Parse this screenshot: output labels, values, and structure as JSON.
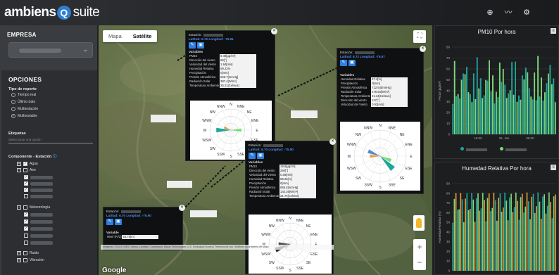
{
  "app": {
    "logo_part1": "ambiens",
    "logo_q": "Q",
    "logo_part2": "suite"
  },
  "topbar": {
    "icons": [
      "plus-circle-icon",
      "chart-line-icon",
      "settings-icon"
    ]
  },
  "sidebar": {
    "empresa_label": "EMPRESA",
    "opciones_label": "OPCIONES",
    "tipo_reporte_label": "Tipo de reporte",
    "report_types": [
      {
        "label": "Tiempo real",
        "checked": false
      },
      {
        "label": "Último dato",
        "checked": false
      },
      {
        "label": "Multiestación",
        "checked": false
      },
      {
        "label": "Multivariable",
        "checked": true
      }
    ],
    "etiquetas_label": "Etiquetas",
    "etiquetas_placeholder": "Seleccionar una opción",
    "componente_label": "Componente - Estación",
    "tree": [
      {
        "label": "Agua",
        "level": 0,
        "checked": true
      },
      {
        "label": "Aire",
        "level": 0,
        "checked": false
      },
      {
        "label": "Meteorología",
        "level": 0,
        "checked": false
      },
      {
        "label": "Ruido",
        "level": 0,
        "checked": false
      },
      {
        "label": "Vibración",
        "level": 0,
        "checked": false
      }
    ]
  },
  "map": {
    "tabs": [
      "Mapa",
      "Satélite"
    ],
    "active_tab": "Satélite",
    "google_label": "Google",
    "attribution": "Imágenes ©2023 CNES / Airbus, Landsat / Copernicus, Maxar Technologies, U.S. Geological Survey | Términos de uso | Notificar un problema de Maps",
    "zoom_in": "+",
    "zoom_out": "−"
  },
  "popups": [
    {
      "est": "Estación:",
      "lat": "Latitud: 6.72 Longitud: -75.91",
      "var_label": "Variables",
      "rows": [
        [
          "PM10",
          "6.49[µg/m³]"
        ],
        [
          "Dirección del viento",
          "66[°]"
        ],
        [
          "Velocidad del Viento",
          "1.94[m/s]"
        ],
        [
          "Humedad Relativa",
          "69.22%"
        ],
        [
          "Precipitación",
          "0[mm]"
        ],
        [
          "Presión Atmosférica",
          "629.7[mmHg]"
        ],
        [
          "Radiación Solar",
          "387.4[W/m²]"
        ],
        [
          "Temperatura Ambiente",
          "25.21[Celsius]"
        ]
      ]
    },
    {
      "est": "Estación:",
      "lat": "Latitud: 6.72 Longitud: -75.87",
      "var_label": "Variables",
      "rows": [
        [
          "Humedad Relativa",
          "67.4[%]"
        ],
        [
          "Precipitación",
          "0[mm]"
        ],
        [
          "Presión Atmosférica",
          "712.64[mmHg]"
        ],
        [
          "Radiación Solar",
          "476.55[W/m²]"
        ],
        [
          "Temperatura Ambiente",
          "21.24[Celsius]"
        ],
        [
          "Dirección del viento",
          "117[°]"
        ],
        [
          "Velocidad del Viento",
          "0.92[m/s]"
        ]
      ]
    },
    {
      "est": "Estación:",
      "lat": "Latitud: 6.70 Longitud: -75.90",
      "var_label": "Variables",
      "rows": [
        [
          "PM10",
          "19.8[µg/m³]"
        ],
        [
          "Dirección del viento",
          "260[°]"
        ],
        [
          "Velocidad del Viento",
          "0.08[m/s]"
        ],
        [
          "Humedad Relativa",
          "88.25[%]"
        ],
        [
          "Precipitación",
          "0[mm]"
        ],
        [
          "Presión Atmosférica",
          "665.4[mmHg]"
        ],
        [
          "Radiación Solar",
          "144.36[W/m²]"
        ],
        [
          "Temperatura Ambiente",
          "21.74[Celsius]"
        ]
      ]
    },
    {
      "est": "Estación:",
      "lat": "Latitud: 6.70 Longitud: -75.90",
      "var_label": "Variable",
      "rows": [
        [
          "Nivel (Ft/2)",
          "53.78[m]"
        ]
      ]
    }
  ],
  "rose_labels": [
    "N",
    "NNE",
    "NE",
    "ENE",
    "E",
    "ESE",
    "SE",
    "SSE",
    "S",
    "SSW",
    "SW",
    "WSW",
    "W",
    "WNW",
    "NW",
    "NNW"
  ],
  "chart1": {
    "title": "PM10 Por hora",
    "ylabel": "PM10 (µg/m³)",
    "x_ticks": [
      "18:00",
      "26. Jan",
      "06:00"
    ],
    "y_ticks": [
      "0",
      "10",
      "20",
      "30",
      "40",
      "50",
      "60",
      "70",
      "80"
    ],
    "series_colors": [
      "#1fa59a",
      "#7cd97c"
    ]
  },
  "chart2": {
    "title": "Humedad Relativa Por hora",
    "ylabel": "Humedad Relativa (%)",
    "y_ticks": [
      "0",
      "10",
      "20",
      "30",
      "40",
      "50",
      "60",
      "70",
      "80",
      "90"
    ],
    "series_colors": [
      "#1fa59a",
      "#7cd97c",
      "#e8a23a"
    ]
  }
}
